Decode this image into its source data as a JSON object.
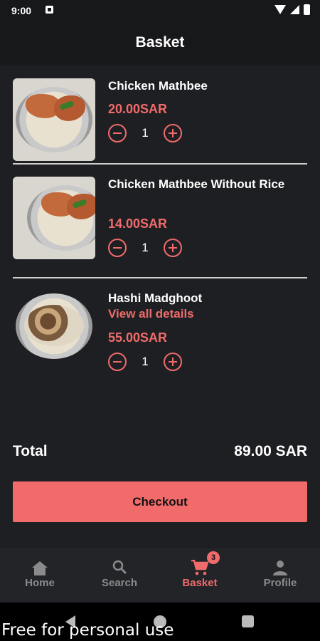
{
  "status_bar": {
    "time": "9:00"
  },
  "header": {
    "title": "Basket"
  },
  "items": [
    {
      "name": "Chicken Mathbee",
      "price": "20.00SAR",
      "quantity": "1"
    },
    {
      "name": "Chicken Mathbee Without Rice",
      "price": "14.00SAR",
      "quantity": "1"
    },
    {
      "name": "Hashi Madghoot",
      "details_link": "View all details",
      "price": "55.00SAR",
      "quantity": "1"
    }
  ],
  "summary": {
    "total_label": "Total",
    "total_value": "89.00 SAR"
  },
  "checkout": {
    "label": "Checkout"
  },
  "bottom_nav": {
    "items": [
      {
        "label": "Home",
        "icon": "home-icon"
      },
      {
        "label": "Search",
        "icon": "search-icon"
      },
      {
        "label": "Basket",
        "icon": "cart-icon",
        "badge": "3",
        "active": true
      },
      {
        "label": "Profile",
        "icon": "person-icon"
      }
    ]
  },
  "colors": {
    "accent": "#f26b6b",
    "background": "#1e1f22"
  },
  "watermark": "Free for personal use"
}
